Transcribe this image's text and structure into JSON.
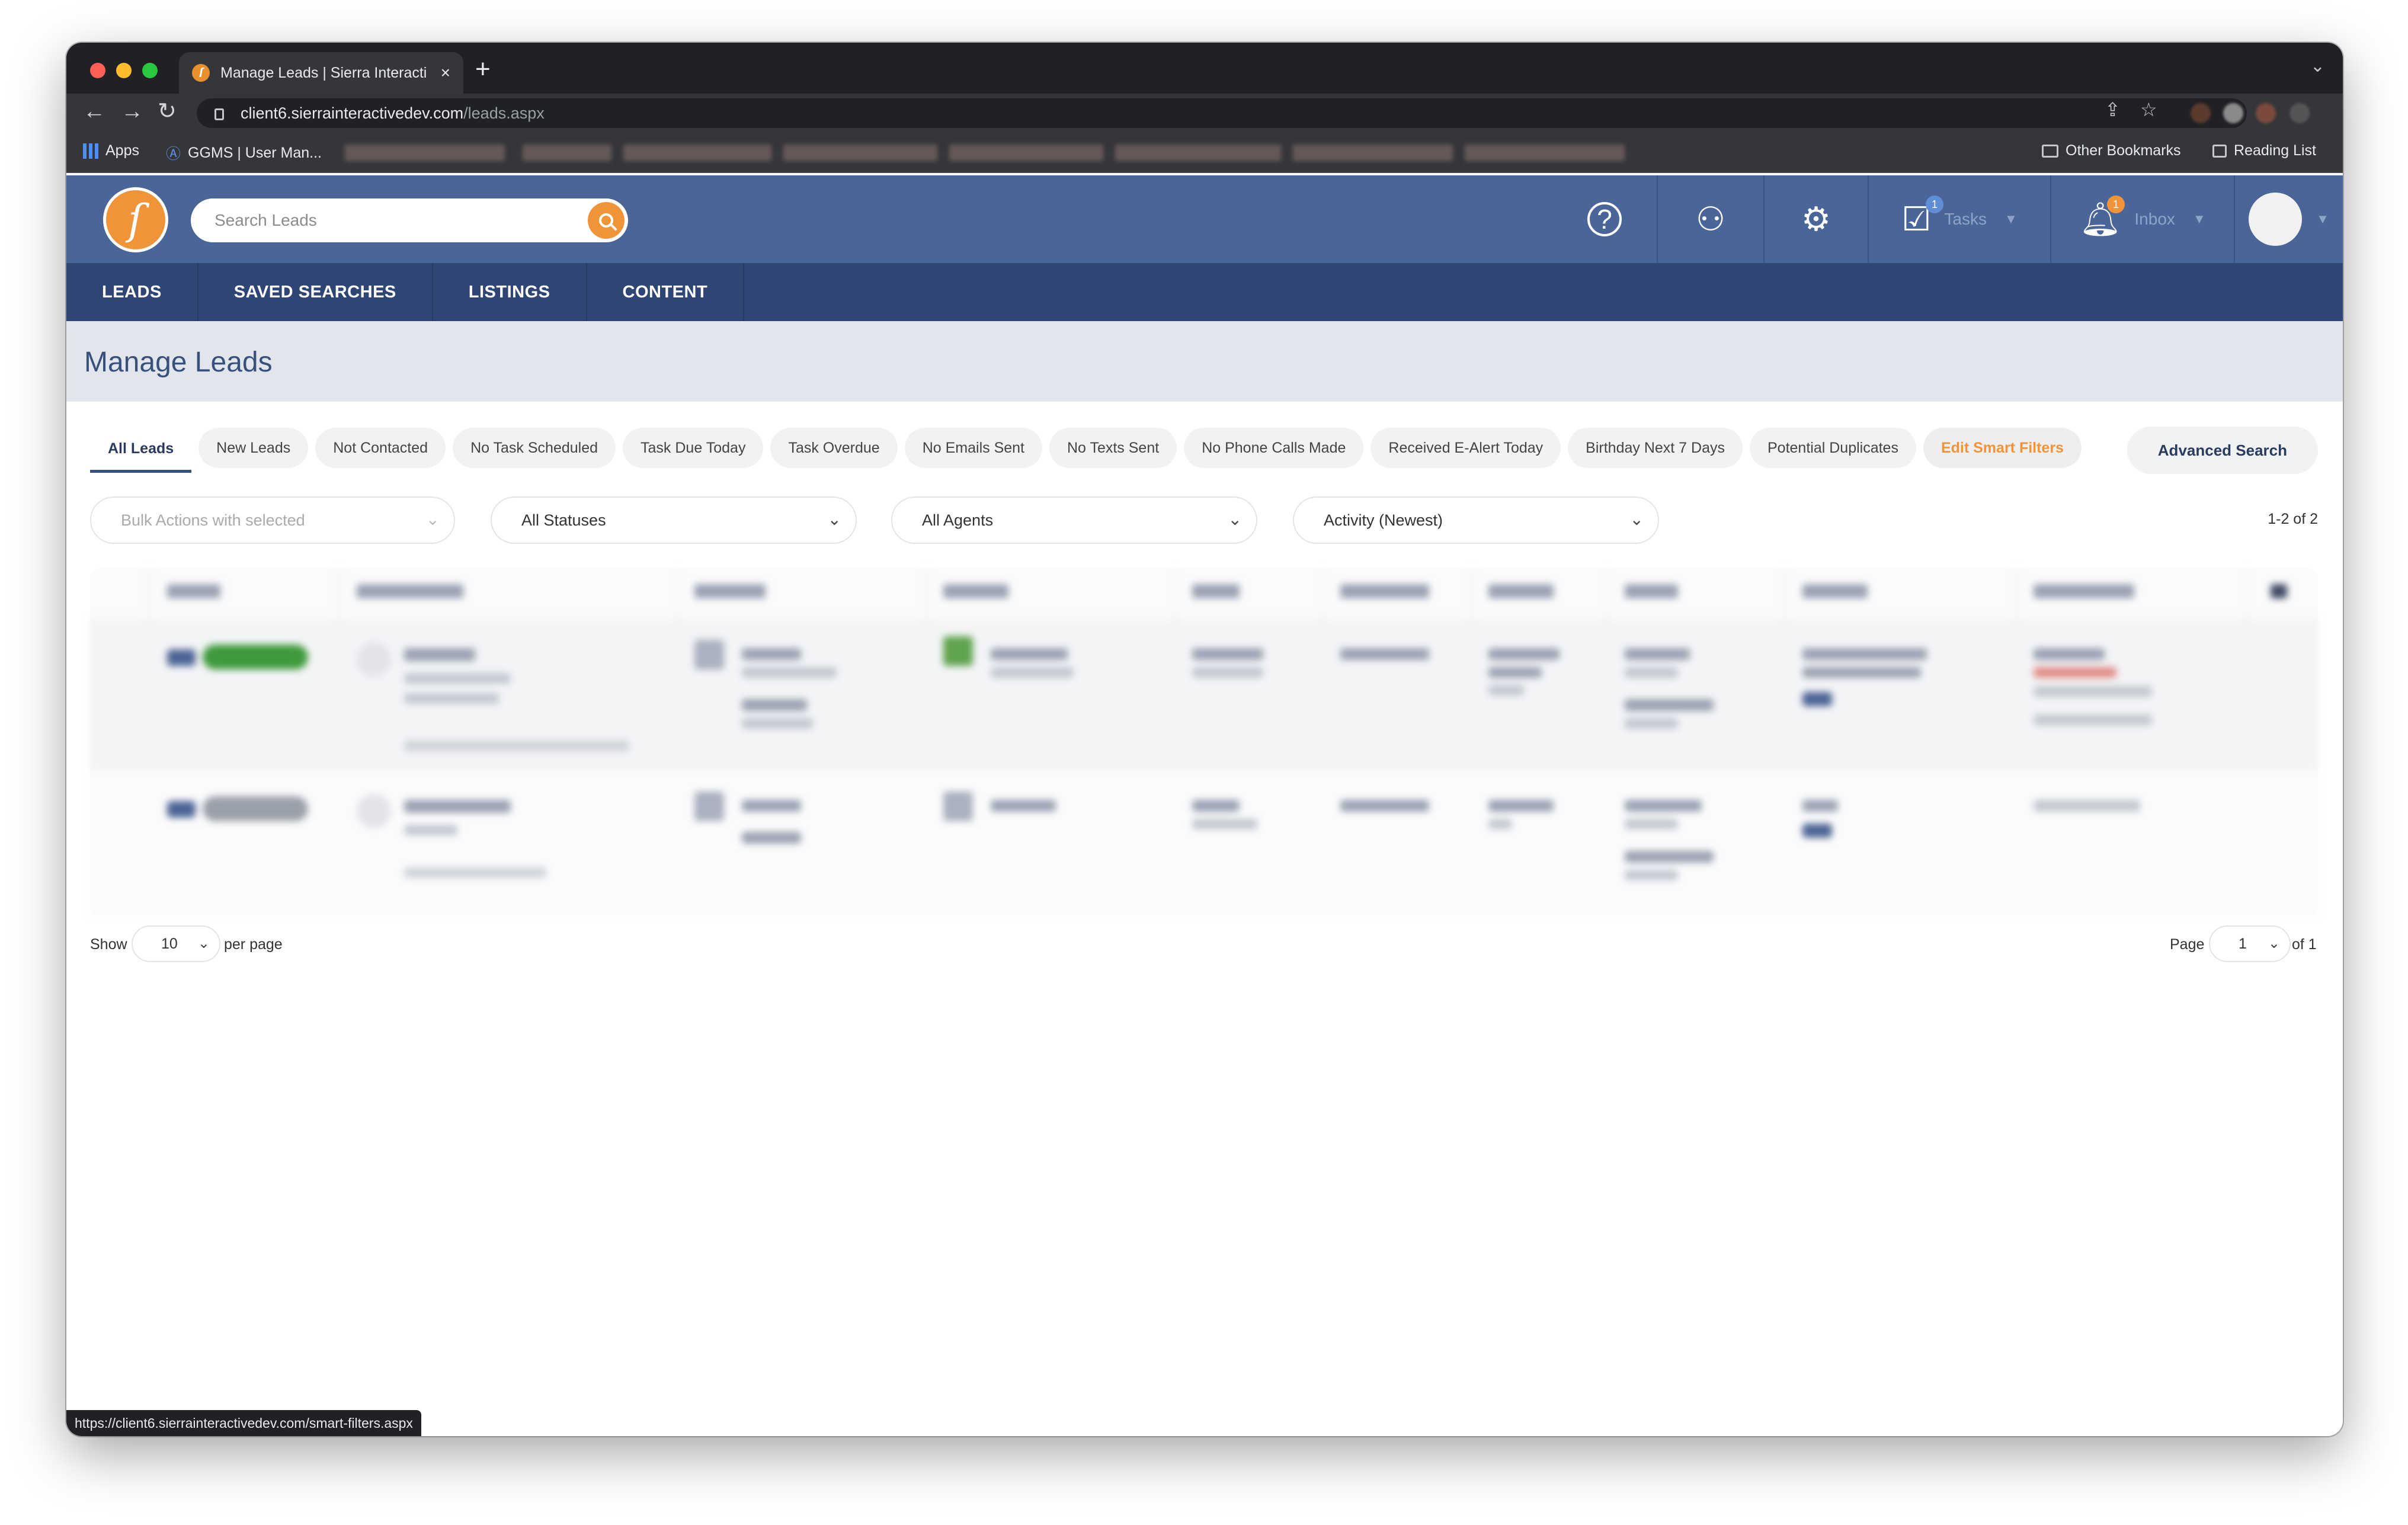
{
  "browser": {
    "tab_title": "Manage Leads | Sierra Interacti",
    "tab_close": "×",
    "new_tab": "+",
    "url_host": "client6.sierrainteractivedev.com",
    "url_path": "/leads.aspx",
    "bookmarks": {
      "apps": "Apps",
      "ggms": "GGMS | User Man...",
      "other": "Other Bookmarks",
      "reading_list": "Reading List"
    },
    "status_url": "https://client6.sierrainteractivedev.com/smart-filters.aspx"
  },
  "header": {
    "logo_glyph": "ſ",
    "search_placeholder": "Search Leads",
    "tasks_label": "Tasks",
    "tasks_badge": "1",
    "inbox_label": "Inbox",
    "inbox_badge": "1"
  },
  "nav": {
    "items": [
      {
        "label": "LEADS"
      },
      {
        "label": "SAVED SEARCHES"
      },
      {
        "label": "LISTINGS"
      },
      {
        "label": "CONTENT"
      }
    ]
  },
  "page": {
    "title": "Manage Leads"
  },
  "filters": {
    "tabs": [
      {
        "label": "All Leads"
      },
      {
        "label": "New Leads"
      },
      {
        "label": "Not Contacted"
      },
      {
        "label": "No Task Scheduled"
      },
      {
        "label": "Task Due Today"
      },
      {
        "label": "Task Overdue"
      },
      {
        "label": "No Emails Sent"
      },
      {
        "label": "No Texts Sent"
      },
      {
        "label": "No Phone Calls Made"
      },
      {
        "label": "Received E-Alert Today"
      },
      {
        "label": "Birthday Next 7 Days"
      },
      {
        "label": "Potential Duplicates"
      }
    ],
    "edit_smart": "Edit Smart Filters",
    "advanced_search": "Advanced Search"
  },
  "controls": {
    "bulk_actions": "Bulk Actions with selected",
    "statuses": "All Statuses",
    "agents": "All Agents",
    "sort": "Activity (Newest)",
    "results": "1-2 of 2"
  },
  "pagination": {
    "show": "Show",
    "per_page_value": "10",
    "per_page": "per page",
    "page": "Page",
    "page_value": "1",
    "of": "of 1"
  },
  "colors": {
    "brand_blue": "#4a6597",
    "nav_blue": "#2f4674",
    "accent_orange": "#f0943a"
  }
}
